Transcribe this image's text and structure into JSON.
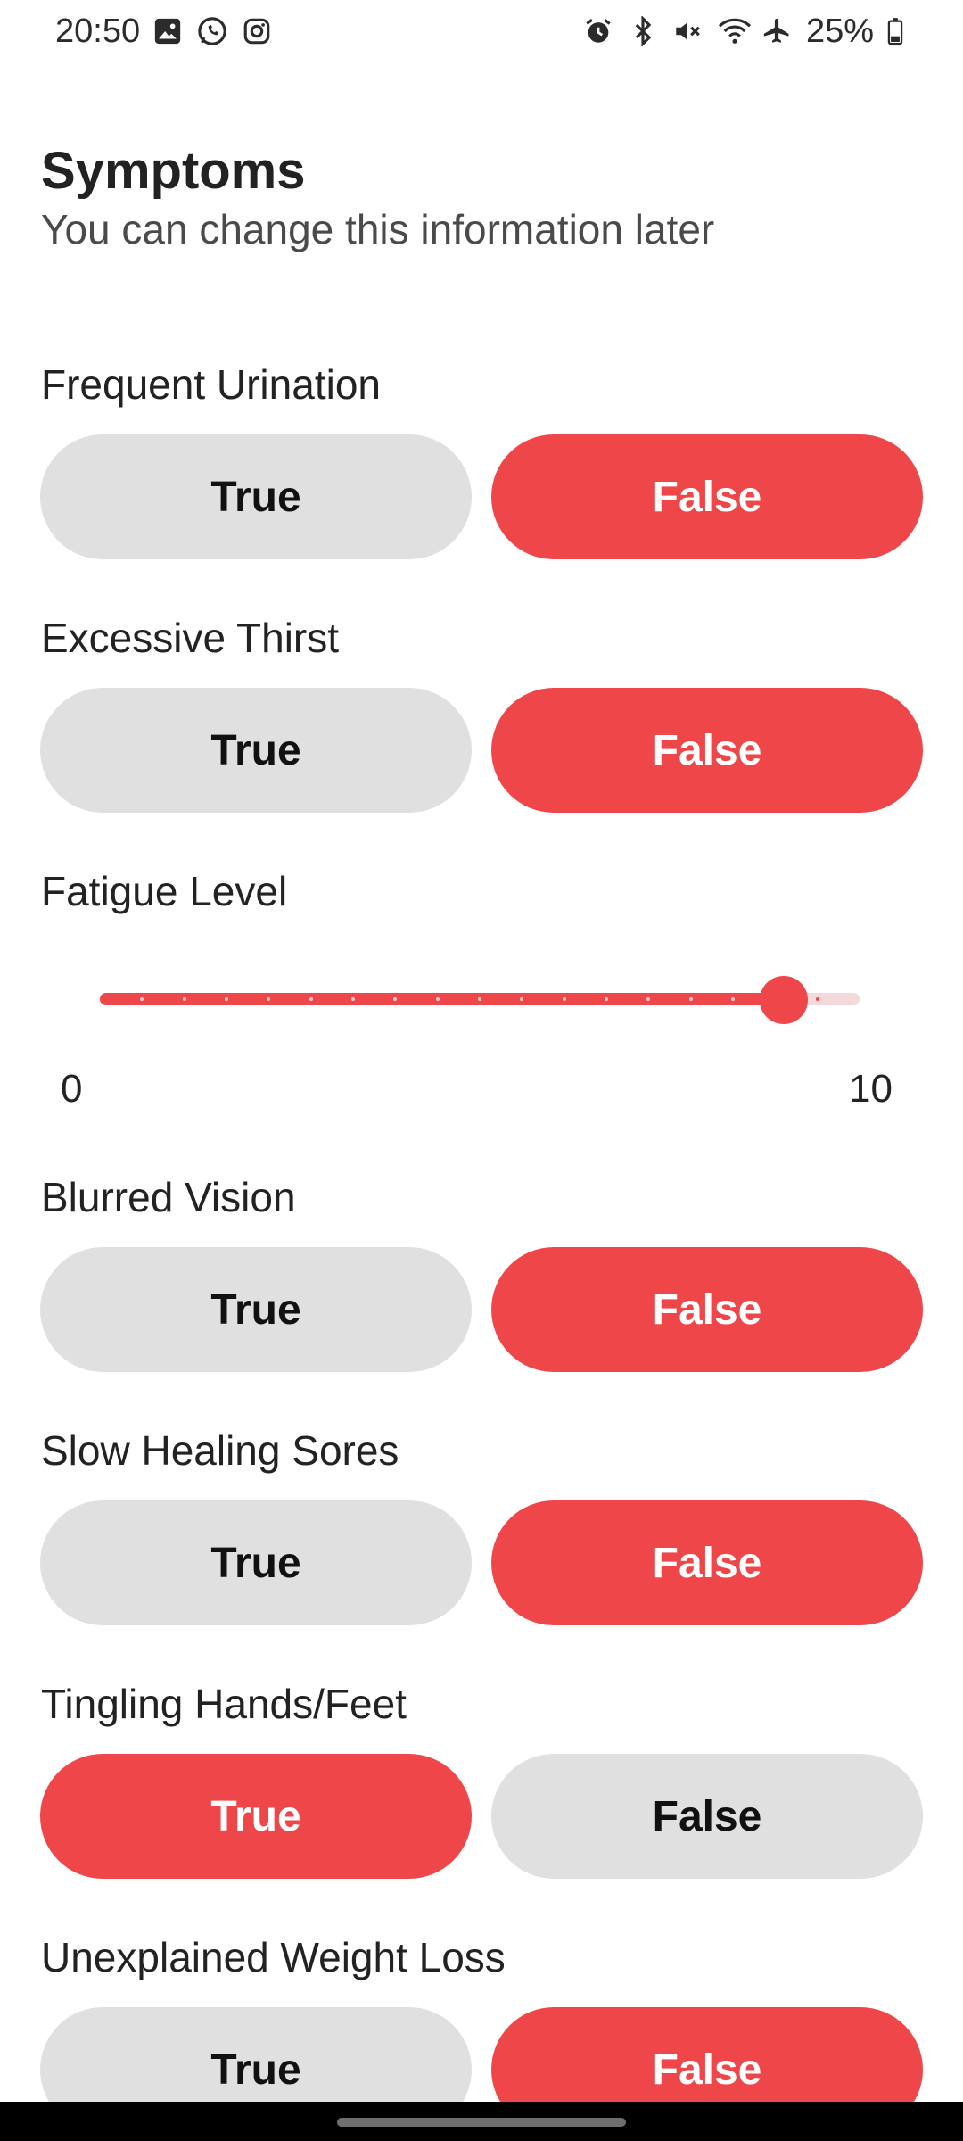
{
  "status_bar": {
    "time": "20:50",
    "battery": "25%",
    "icons_left": [
      "gallery-icon",
      "whatsapp-icon",
      "instagram-icon"
    ],
    "icons_right": [
      "alarm-icon",
      "bluetooth-icon",
      "mute-icon",
      "wifi-icon",
      "airplane-icon",
      "battery-icon"
    ]
  },
  "header": {
    "title": "Symptoms",
    "subtitle": "You can change this information later"
  },
  "questions": [
    {
      "label": "Frequent Urination",
      "true_label": "True",
      "false_label": "False",
      "selected": "False"
    },
    {
      "label": "Excessive Thirst",
      "true_label": "True",
      "false_label": "False",
      "selected": "False"
    },
    {
      "label": "Blurred Vision",
      "true_label": "True",
      "false_label": "False",
      "selected": "False"
    },
    {
      "label": "Slow Healing Sores",
      "true_label": "True",
      "false_label": "False",
      "selected": "False"
    },
    {
      "label": "Tingling Hands/Feet",
      "true_label": "True",
      "false_label": "False",
      "selected": "True"
    },
    {
      "label": "Unexplained Weight Loss",
      "true_label": "True",
      "false_label": "False",
      "selected": "False"
    }
  ],
  "fatigue": {
    "label": "Fatigue Level",
    "min": 0,
    "max": 10,
    "min_label": "0",
    "max_label": "10",
    "value": 9
  },
  "colors": {
    "accent": "#ef4749",
    "unselected": "#e0e0e0"
  }
}
